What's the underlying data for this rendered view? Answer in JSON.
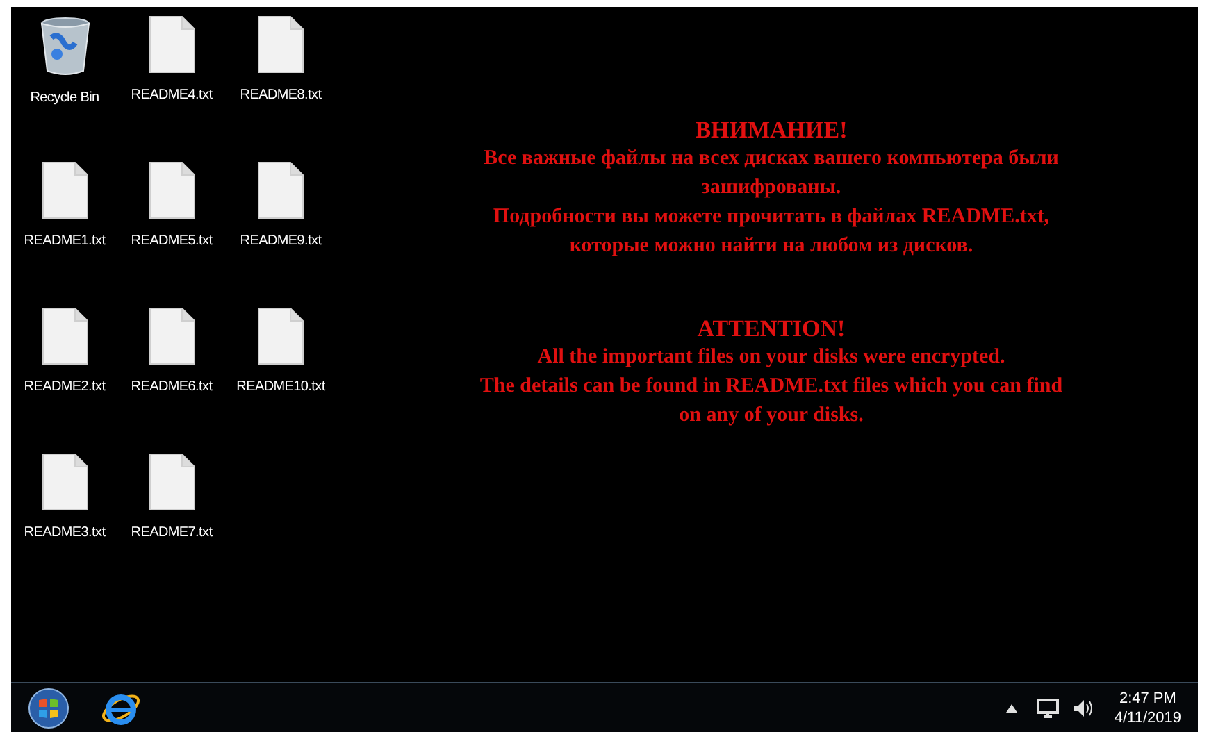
{
  "desktop_icons": [
    {
      "label": "Recycle Bin",
      "kind": "recycle-bin"
    },
    {
      "label": "README4.txt",
      "kind": "text-file"
    },
    {
      "label": "README8.txt",
      "kind": "text-file"
    },
    {
      "label": "README1.txt",
      "kind": "text-file"
    },
    {
      "label": "README5.txt",
      "kind": "text-file"
    },
    {
      "label": "README9.txt",
      "kind": "text-file"
    },
    {
      "label": "README2.txt",
      "kind": "text-file"
    },
    {
      "label": "README6.txt",
      "kind": "text-file"
    },
    {
      "label": "README10.txt",
      "kind": "text-file"
    },
    {
      "label": "README3.txt",
      "kind": "text-file"
    },
    {
      "label": "README7.txt",
      "kind": "text-file"
    }
  ],
  "message": [
    {
      "heading": "ВНИМАНИЕ!",
      "lines": [
        "Все важные файлы на всех дисках вашего компьютера были",
        "зашифрованы.",
        "Подробности вы можете прочитать в файлах README.txt,",
        "которые можно найти на любом из дисков."
      ]
    },
    {
      "heading": "ATTENTION!",
      "lines": [
        "All the important files on your disks were encrypted.",
        "The details can be found in README.txt files which you can find",
        "on any of your disks."
      ]
    }
  ],
  "taskbar": {
    "clock": {
      "time": "2:47 PM",
      "date": "4/11/2019"
    }
  }
}
